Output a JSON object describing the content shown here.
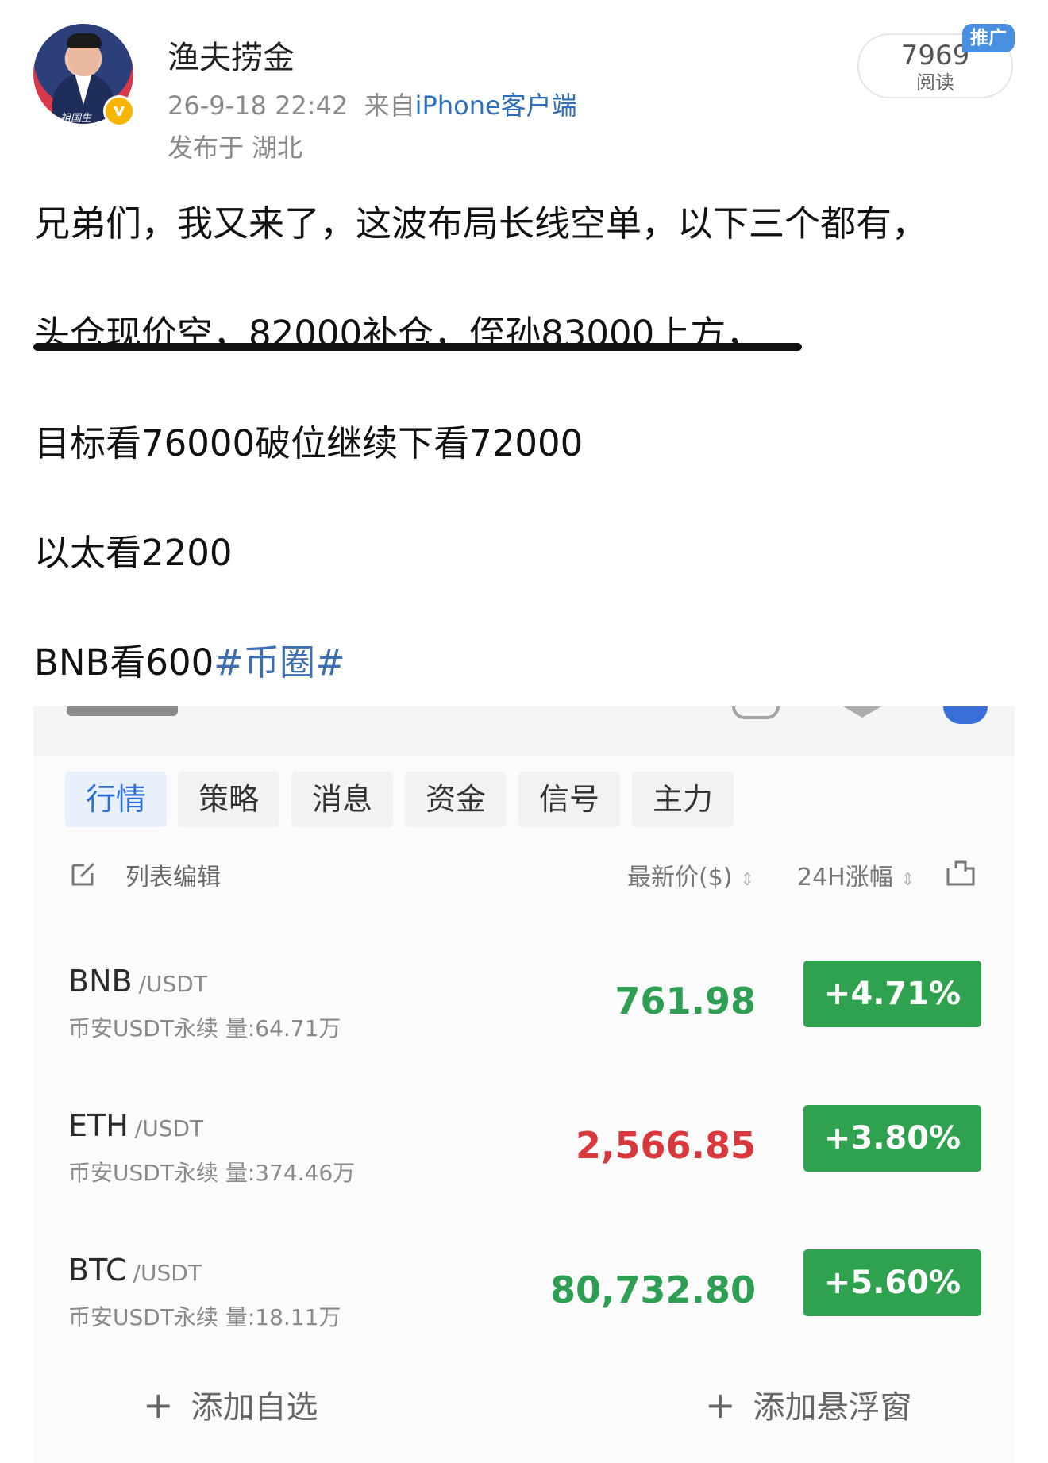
{
  "header": {
    "username": "渔夫捞金",
    "timestamp": "26-9-18 22:42",
    "source_prefix": "来自",
    "source": "iPhone客户端",
    "location": "发布于 湖北",
    "reads_count": "7969",
    "reads_label": "阅读",
    "promo_badge": "推广",
    "avatar_caption": "祖国生"
  },
  "post": {
    "line1": "兄弟们，我又来了，这波布局长线空单，以下三个都有，",
    "line2": "头仓现价空，82000补仓，侄孙83000上方，",
    "line3": "目标看76000破位继续下看72000",
    "line4": "以太看2200",
    "line5_text": "BNB看600",
    "hashtag": "#币圈#"
  },
  "app": {
    "tabs": [
      "行情",
      "策略",
      "消息",
      "资金",
      "信号",
      "主力"
    ],
    "active_tab": "行情",
    "list_edit_label": "列表编辑",
    "col_price": "最新价($)",
    "col_change": "24H涨幅",
    "rows": [
      {
        "symbol": "BNB",
        "quote": "/USDT",
        "sub": "币安USDT永续 量:64.71万",
        "price": "761.98",
        "change": "+4.71%",
        "price_color": "#2e9e52"
      },
      {
        "symbol": "ETH",
        "quote": "/USDT",
        "sub": "币安USDT永续 量:374.46万",
        "price": "2,566.85",
        "change": "+3.80%",
        "price_color": "#d8383c"
      },
      {
        "symbol": "BTC",
        "quote": "/USDT",
        "sub": "币安USDT永续 量:18.11万",
        "price": "80,732.80",
        "change": "+5.60%",
        "price_color": "#2e9e52"
      }
    ],
    "add_watchlist": "添加自选",
    "add_float": "添加悬浮窗",
    "badge_color": "#2ea24e",
    "accent": "#2e6fd6"
  }
}
